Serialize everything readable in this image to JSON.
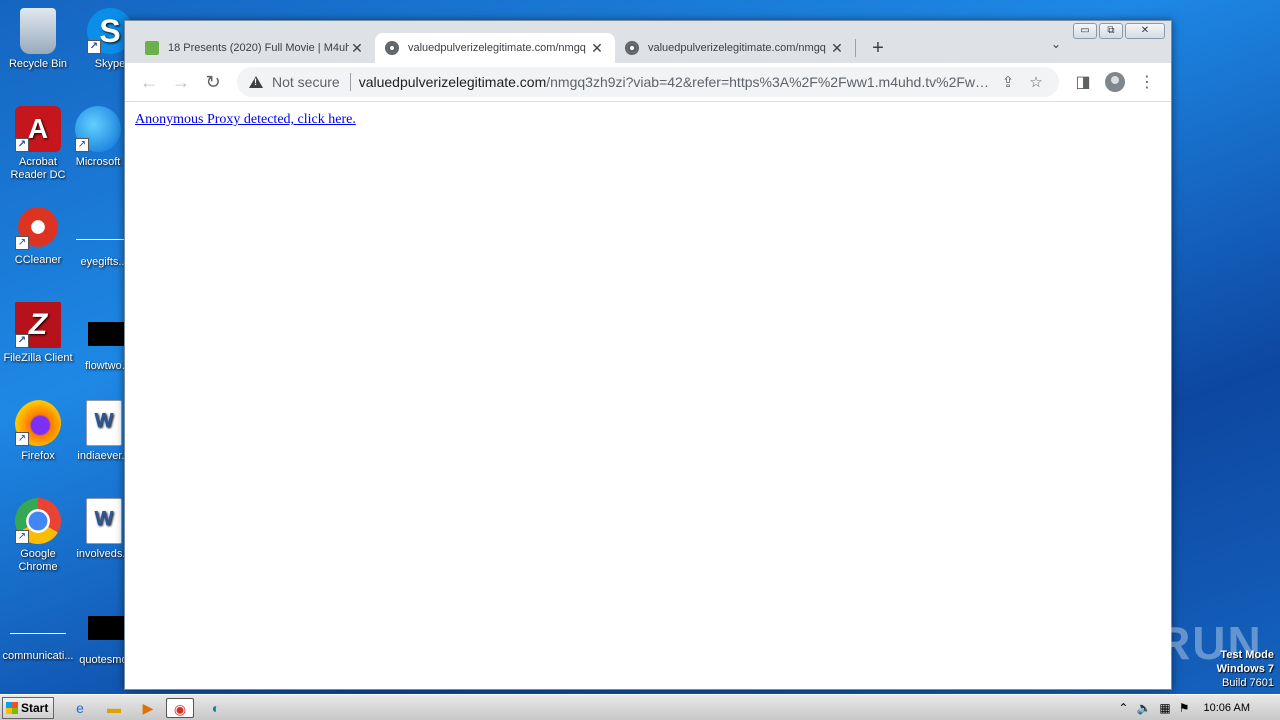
{
  "desktop": {
    "icons": [
      {
        "label": "Recycle Bin"
      },
      {
        "label": "Skype"
      },
      {
        "label": "Acrobat Reader DC"
      },
      {
        "label": "Microsoft"
      },
      {
        "label": "CCleaner"
      },
      {
        "label": "eyegifts..."
      },
      {
        "label": "FileZilla Client"
      },
      {
        "label": "flowtwo..."
      },
      {
        "label": "Firefox"
      },
      {
        "label": "indiaever..."
      },
      {
        "label": "Google Chrome"
      },
      {
        "label": "involveds..."
      },
      {
        "label": "communicati..."
      },
      {
        "label": "quotesmo..."
      }
    ],
    "watermark": "ANY RUN",
    "test_mode": {
      "line1": "Test Mode",
      "line2": "Windows 7",
      "line3": "Build 7601"
    }
  },
  "browser": {
    "tabs": [
      {
        "title": "18 Presents (2020) Full Movie | M4uh",
        "favicon": "green-icon",
        "active": false
      },
      {
        "title": "valuedpulverizelegitimate.com/nmgq",
        "favicon": "globe-icon",
        "active": true
      },
      {
        "title": "valuedpulverizelegitimate.com/nmgq",
        "favicon": "globe-icon",
        "active": false
      }
    ],
    "window_controls": {
      "minimize": "▭",
      "restore": "⧉",
      "close": "✕"
    },
    "omnibox": {
      "security_label": "Not secure",
      "url_host": "valuedpulverizelegitimate.com",
      "url_path": "/nmgq3zh9zi?viab=42&refer=https%3A%2F%2Fww1.m4uhd.tv%2Fwat..."
    },
    "page": {
      "link_text": "Anonymous Proxy detected, click here."
    }
  },
  "taskbar": {
    "start_label": "Start",
    "clock": "10:06 AM"
  }
}
